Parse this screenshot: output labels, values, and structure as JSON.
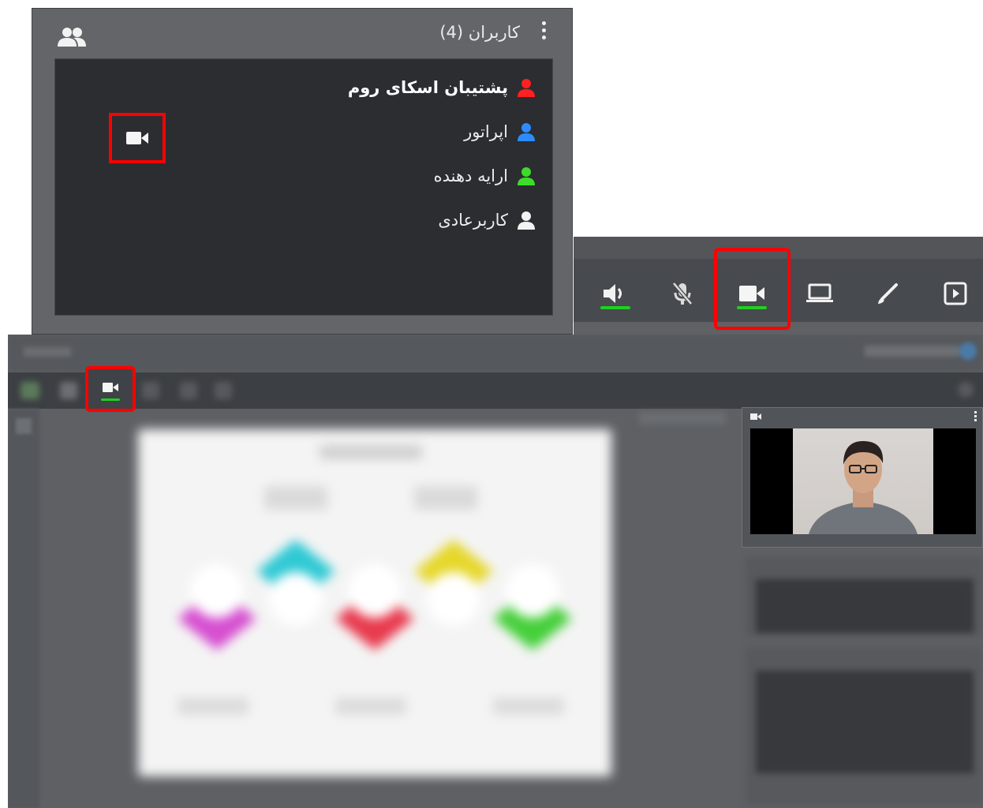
{
  "users_panel": {
    "title": "کاربران (4)",
    "icons": {
      "group": "group-icon",
      "more": "more-vertical-icon",
      "camera": "video-camera-icon"
    },
    "users": [
      {
        "name": "پشتیبان اسکای روم",
        "role_color": "#ff2020",
        "bold": true,
        "camera_on": true
      },
      {
        "name": "اپراتور",
        "role_color": "#2c8cff",
        "bold": false,
        "camera_on": false
      },
      {
        "name": "ارایه دهنده",
        "role_color": "#3ddc2a",
        "bold": false,
        "camera_on": false
      },
      {
        "name": "کاربرعادی",
        "role_color": "#f2f2f2",
        "bold": false,
        "camera_on": false
      }
    ]
  },
  "toolbar": {
    "buttons": [
      {
        "name": "speaker",
        "icon": "speaker-icon",
        "active": true
      },
      {
        "name": "microphone",
        "icon": "mic-off-icon",
        "active": false
      },
      {
        "name": "camera",
        "icon": "video-camera-icon",
        "active": true,
        "highlighted": true
      },
      {
        "name": "screen-share",
        "icon": "laptop-icon",
        "active": false
      },
      {
        "name": "whiteboard",
        "icon": "brush-icon",
        "active": false
      },
      {
        "name": "presentation",
        "icon": "presentation-icon",
        "active": false
      }
    ]
  },
  "colors": {
    "highlight": "#ff0000",
    "active_indicator": "#1fcf1f",
    "panel_bg": "#2b2d31"
  }
}
